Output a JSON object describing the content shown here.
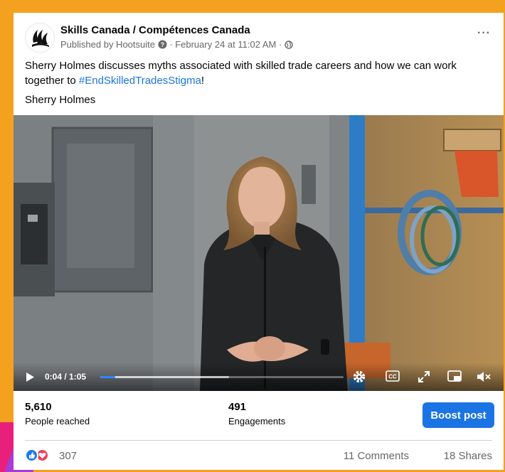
{
  "post": {
    "page_name": "Skills Canada / Compétences Canada",
    "published_by": "Published by Hootsuite",
    "date": "February 24 at 11:02 AM",
    "dot": "·",
    "more": "···",
    "text": "Sherry Holmes discusses myths associated with skilled trade careers and how we can work together to ",
    "hashtag": "#EndSkilledTradesStigma",
    "text_end": "!",
    "name_line": "Sherry Holmes"
  },
  "video": {
    "current_time": "0:04",
    "duration": "1:05",
    "time_display": "0:04 / 1:05",
    "progress": 0.06,
    "buffered": 0.53,
    "icons": [
      "play-icon",
      "settings-icon",
      "captions-icon",
      "fullscreen-icon",
      "pip-icon",
      "mute-icon"
    ],
    "cc_label": "CC"
  },
  "stats": {
    "reached_value": "5,610",
    "reached_label": "People reached",
    "engagements_value": "491",
    "engagements_label": "Engagements",
    "boost_label": "Boost post"
  },
  "footer": {
    "reaction_count": "307",
    "comments": "11 Comments",
    "shares": "18 Shares"
  },
  "colors": {
    "frame": "#f4a11f",
    "accent": "#1b74e4",
    "like": "#1877f2",
    "love": "#f33e58"
  }
}
